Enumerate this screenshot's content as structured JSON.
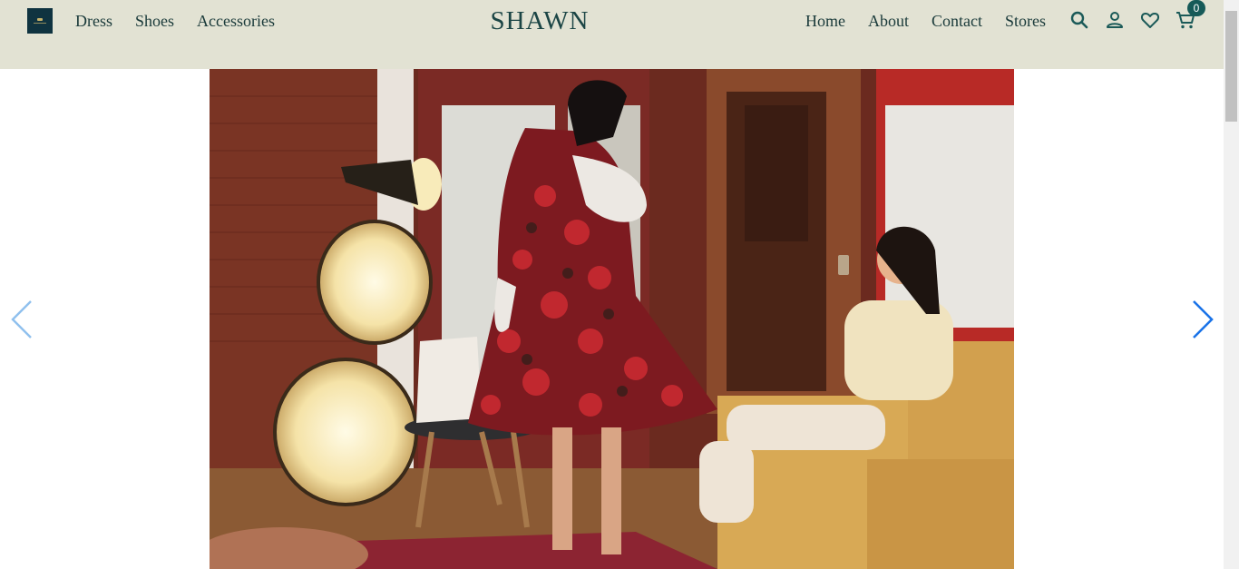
{
  "header": {
    "brand": "SHAWN",
    "nav_left": [
      "Dress",
      "Shoes",
      "Accessories"
    ],
    "nav_right": [
      "Home",
      "About",
      "Contact",
      "Stores"
    ],
    "cart_count": "0"
  },
  "icons": {
    "logo": "store-logo",
    "search": "search-icon",
    "account": "user-icon",
    "wishlist": "heart-icon",
    "cart": "cart-icon",
    "prev": "chevron-left-icon",
    "next": "chevron-right-icon"
  },
  "colors": {
    "header_bg": "#e2e2d3",
    "brand_text": "#1b4545",
    "badge": "#165a58",
    "arrow": "#1a73e8"
  },
  "slider": {
    "current": 1
  }
}
